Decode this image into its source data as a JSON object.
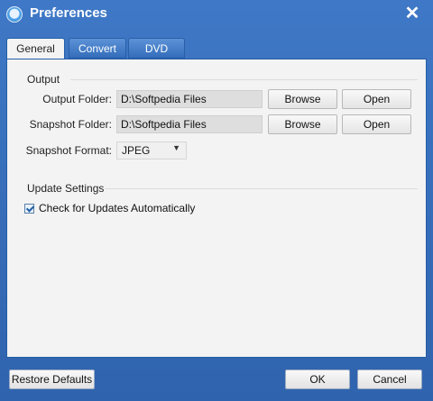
{
  "window": {
    "title": "Preferences",
    "close_label": "✕"
  },
  "tabs": [
    {
      "label": "General",
      "active": true
    },
    {
      "label": "Convert",
      "active": false
    },
    {
      "label": "DVD",
      "active": false
    }
  ],
  "output": {
    "section_label": "Output",
    "output_folder_label": "Output Folder:",
    "output_folder_value": "D:\\Softpedia Files",
    "snapshot_folder_label": "Snapshot Folder:",
    "snapshot_folder_value": "D:\\Softpedia Files",
    "browse_label": "Browse",
    "open_label": "Open",
    "snapshot_format_label": "Snapshot Format:",
    "snapshot_format_value": "JPEG"
  },
  "update": {
    "section_label": "Update Settings",
    "check_label": "Check for Updates Automatically",
    "checked": true
  },
  "footer": {
    "restore_label": "Restore Defaults",
    "ok_label": "OK",
    "cancel_label": "Cancel"
  },
  "colors": {
    "titlebar": "#3a6db3",
    "panel": "#f3f3f3"
  },
  "icons": {
    "app": "app-logo-icon",
    "close": "close-icon",
    "dropdown": "chevron-down-icon"
  }
}
